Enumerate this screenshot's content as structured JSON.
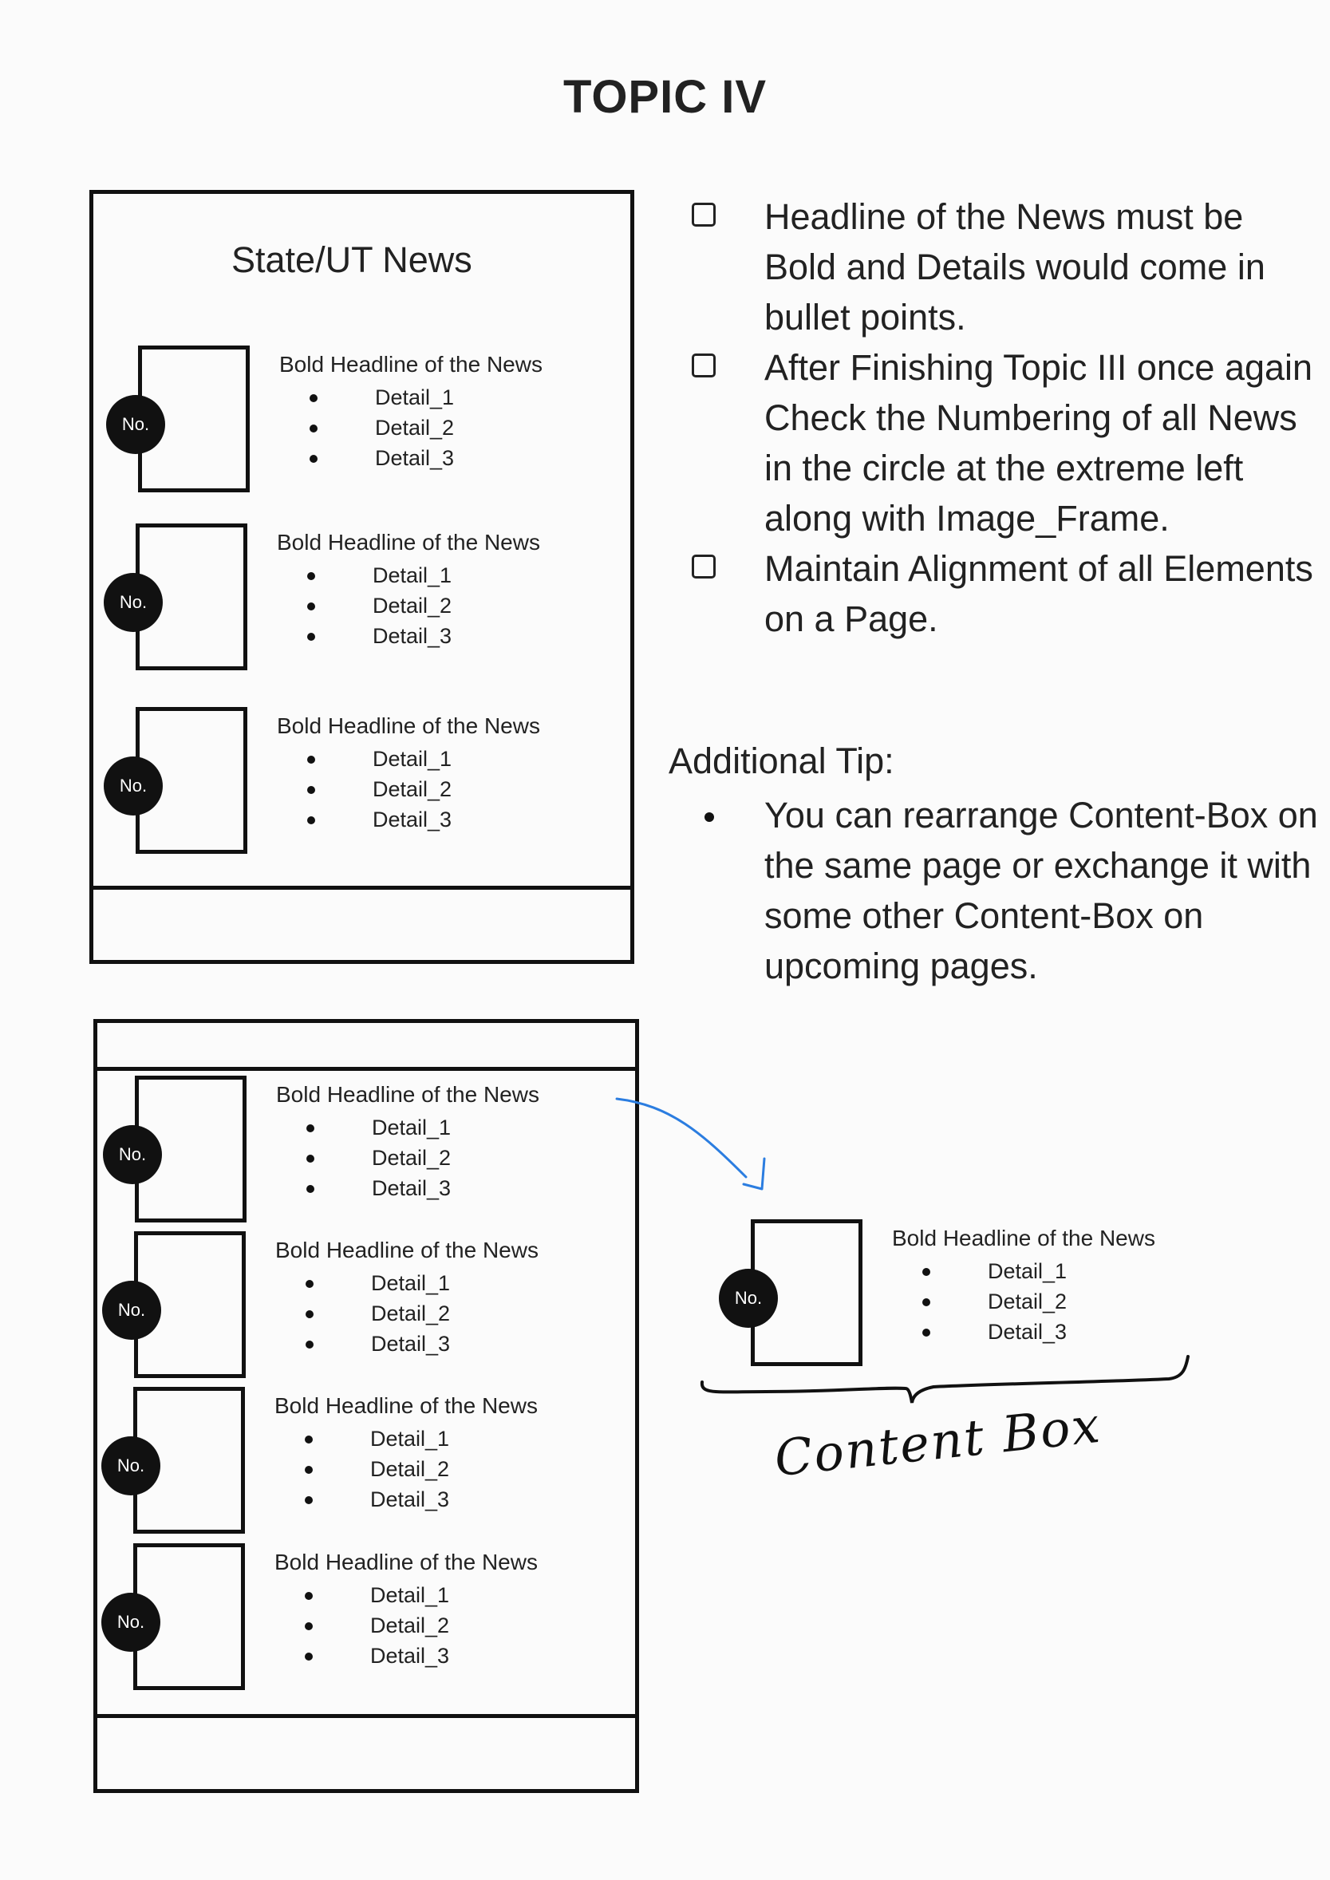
{
  "page": {
    "title": "TOPIC IV"
  },
  "frame1": {
    "title": "State/UT News",
    "items": [
      {
        "number": "No.",
        "headline": "Bold Headline of the News",
        "details": [
          "Detail_1",
          "Detail_2",
          "Detail_3"
        ]
      },
      {
        "number": "No.",
        "headline": "Bold Headline of the News",
        "details": [
          "Detail_1",
          "Detail_2",
          "Detail_3"
        ]
      },
      {
        "number": "No.",
        "headline": "Bold Headline of the News",
        "details": [
          "Detail_1",
          "Detail_2",
          "Detail_3"
        ]
      }
    ]
  },
  "frame2": {
    "items": [
      {
        "number": "No.",
        "headline": "Bold Headline of the News",
        "details": [
          "Detail_1",
          "Detail_2",
          "Detail_3"
        ]
      },
      {
        "number": "No.",
        "headline": "Bold Headline of the News",
        "details": [
          "Detail_1",
          "Detail_2",
          "Detail_3"
        ]
      },
      {
        "number": "No.",
        "headline": "Bold Headline of the News",
        "details": [
          "Detail_1",
          "Detail_2",
          "Detail_3"
        ]
      },
      {
        "number": "No.",
        "headline": "Bold Headline of the News",
        "details": [
          "Detail_1",
          "Detail_2",
          "Detail_3"
        ]
      }
    ]
  },
  "content_box": {
    "number": "No.",
    "headline": "Bold Headline of the News",
    "details": [
      "Detail_1",
      "Detail_2",
      "Detail_3"
    ],
    "label": "Content Box"
  },
  "checklist": [
    "Headline of the News must be Bold and Details would come in bullet points.",
    "After Finishing Topic III once again Check the Numbering of all News in the circle at the extreme left along with Image_Frame.",
    "Maintain Alignment of all Elements on a Page."
  ],
  "additional_tip": {
    "heading": "Additional Tip:",
    "items": [
      "You can rearrange Content-Box on the same page or exchange it with some other Content-Box on upcoming pages."
    ]
  },
  "colors": {
    "arrow": "#2b7de0",
    "ink": "#111111",
    "background": "#fbfbfb"
  }
}
